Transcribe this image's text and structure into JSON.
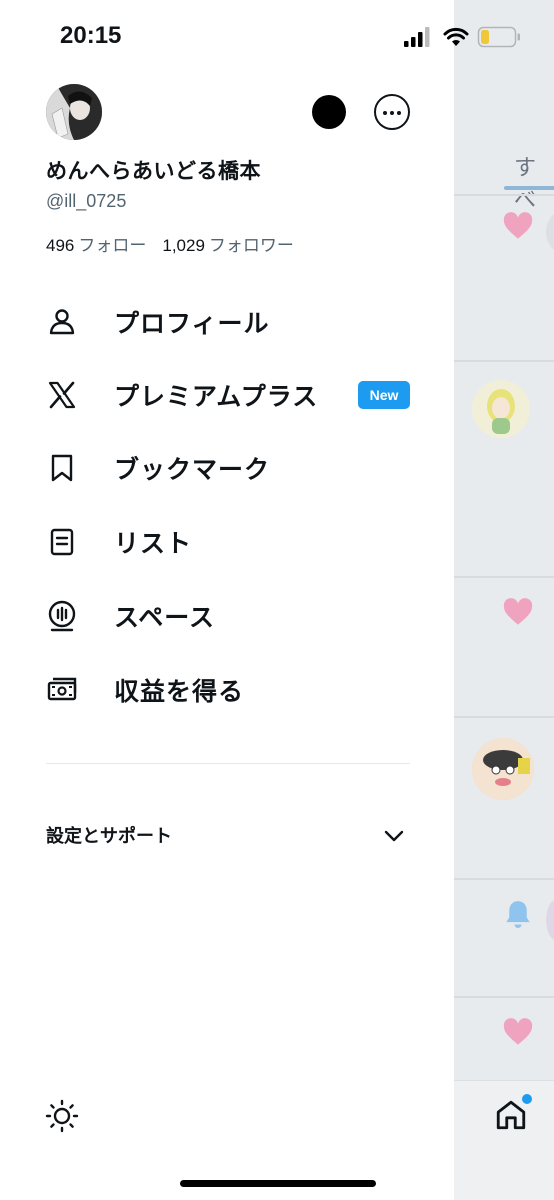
{
  "status_bar": {
    "time": "20:15"
  },
  "profile": {
    "display_name": "めんへらあいどる橋本",
    "handle": "@ill_0725",
    "following_count": "496",
    "following_label": "フォロー",
    "followers_count": "1,029",
    "followers_label": "フォロワー"
  },
  "menu": {
    "items": [
      {
        "label": "プロフィール",
        "icon": "person-icon"
      },
      {
        "label": "プレミアムプラス",
        "icon": "x-logo-icon",
        "badge": "New"
      },
      {
        "label": "ブックマーク",
        "icon": "bookmark-icon"
      },
      {
        "label": "リスト",
        "icon": "list-icon"
      },
      {
        "label": "スペース",
        "icon": "spaces-icon"
      },
      {
        "label": "収益を得る",
        "icon": "money-icon"
      }
    ]
  },
  "settings": {
    "label": "設定とサポート"
  },
  "background": {
    "tab_fragment": "すべ"
  },
  "colors": {
    "accent": "#1d9bf0",
    "text": "#0f1419",
    "secondary": "#536471",
    "like": "#f4a8c4"
  }
}
